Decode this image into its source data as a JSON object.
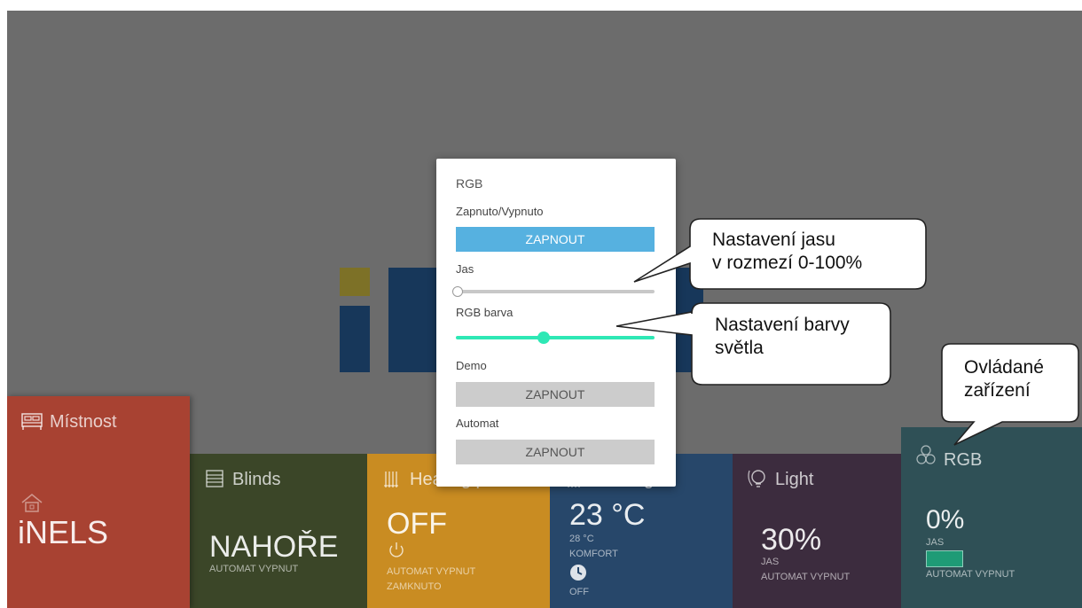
{
  "tiles": {
    "room": {
      "title": "Místnost",
      "value": "iNELS"
    },
    "blinds": {
      "title": "Blinds",
      "value": "NAHOŘE",
      "status": "AUTOMAT VYPNUT"
    },
    "heating_power": {
      "title": "Heating power",
      "value": "OFF",
      "status1": "AUTOMAT VYPNUT",
      "status2": "ZAMKNUTO"
    },
    "heating": {
      "title": "Heating",
      "value": "23 °C",
      "setpoint": "28 °C",
      "mode": "KOMFORT",
      "clock_status": "OFF"
    },
    "light": {
      "title": "Light",
      "value": "30%",
      "unit": "JAS",
      "status": "AUTOMAT VYPNUT"
    },
    "rgb": {
      "title": "RGB",
      "value": "0%",
      "unit": "JAS",
      "status": "AUTOMAT VYPNUT",
      "swatch_color": "#1e9b76"
    }
  },
  "dialog": {
    "title": "RGB",
    "power_label": "Zapnuto/Vypnuto",
    "power_button": "ZAPNOUT",
    "brightness_label": "Jas",
    "brightness_value": 0,
    "color_label": "RGB barva",
    "color_value": 0.44,
    "demo_label": "Demo",
    "demo_button": "ZAPNOUT",
    "automat_label": "Automat",
    "automat_button": "ZAPNOUT"
  },
  "callouts": {
    "brightness_line1": "Nastavení jasu",
    "brightness_line2": "v rozmezí 0-100%",
    "color_line1": "Nastavení barvy",
    "color_line2": "světla",
    "devices_line1": "Ovládané",
    "devices_line2": "zařízení"
  },
  "colors": {
    "accent_blue": "#56b1e0",
    "slider_green": "#2ee8b5",
    "room_tile": "#a84232",
    "heating_power_tile": "#c98c22"
  }
}
